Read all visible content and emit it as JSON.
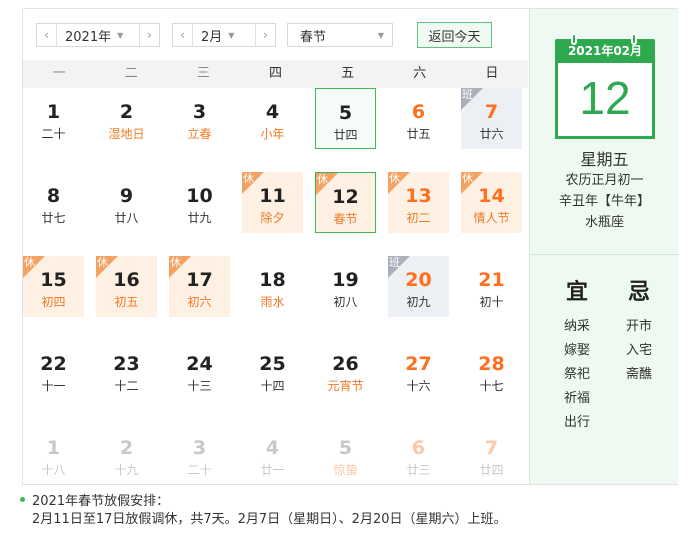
{
  "toolbar": {
    "year": "2021年",
    "month": "2月",
    "holiday": "春节",
    "today_label": "返回今天"
  },
  "weekdays": [
    "一",
    "二",
    "三",
    "四",
    "五",
    "六",
    "日"
  ],
  "days": [
    {
      "n": "1",
      "l": "二十"
    },
    {
      "n": "2",
      "l": "湿地日",
      "fest": true
    },
    {
      "n": "3",
      "l": "立春",
      "fest": true
    },
    {
      "n": "4",
      "l": "小年",
      "fest": true
    },
    {
      "n": "5",
      "l": "廿四",
      "selected": true
    },
    {
      "n": "6",
      "l": "廿五"
    },
    {
      "n": "7",
      "l": "廿六",
      "tag": "班"
    },
    {
      "n": "8",
      "l": "廿七"
    },
    {
      "n": "9",
      "l": "廿八"
    },
    {
      "n": "10",
      "l": "廿九"
    },
    {
      "n": "11",
      "l": "除夕",
      "fest": true,
      "tag": "休"
    },
    {
      "n": "12",
      "l": "春节",
      "fest": true,
      "tag": "休",
      "selected": true
    },
    {
      "n": "13",
      "l": "初二",
      "fest": true,
      "tag": "休"
    },
    {
      "n": "14",
      "l": "情人节",
      "fest": true,
      "tag": "休"
    },
    {
      "n": "15",
      "l": "初四",
      "fest": true,
      "tag": "休"
    },
    {
      "n": "16",
      "l": "初五",
      "fest": true,
      "tag": "休"
    },
    {
      "n": "17",
      "l": "初六",
      "fest": true,
      "tag": "休"
    },
    {
      "n": "18",
      "l": "雨水",
      "fest": true
    },
    {
      "n": "19",
      "l": "初八"
    },
    {
      "n": "20",
      "l": "初九",
      "tag": "班"
    },
    {
      "n": "21",
      "l": "初十"
    },
    {
      "n": "22",
      "l": "十一"
    },
    {
      "n": "23",
      "l": "十二"
    },
    {
      "n": "24",
      "l": "十三"
    },
    {
      "n": "25",
      "l": "十四"
    },
    {
      "n": "26",
      "l": "元宵节",
      "fest": true
    },
    {
      "n": "27",
      "l": "十六"
    },
    {
      "n": "28",
      "l": "十七"
    },
    {
      "n": "1",
      "l": "十八",
      "other": true
    },
    {
      "n": "2",
      "l": "十九",
      "other": true
    },
    {
      "n": "3",
      "l": "二十",
      "other": true
    },
    {
      "n": "4",
      "l": "廿一",
      "other": true
    },
    {
      "n": "5",
      "l": "惊蛰",
      "fest": true,
      "other": true
    },
    {
      "n": "6",
      "l": "廿三",
      "other": true
    },
    {
      "n": "7",
      "l": "廿四",
      "other": true
    }
  ],
  "side": {
    "header": "2021年02月",
    "big_day": "12",
    "weekday": "星期五",
    "lunar": "农历正月初一",
    "ganzhi": "辛丑年【牛年】",
    "zodiac": "水瓶座"
  },
  "yi": {
    "title": "宜",
    "items": [
      "纳采",
      "嫁娶",
      "祭祀",
      "祈福",
      "出行"
    ]
  },
  "ji": {
    "title": "忌",
    "items": [
      "开市",
      "入宅",
      "斋醮"
    ]
  },
  "notice": {
    "title": "2021年春节放假安排：",
    "body": "2月11日至17日放假调休，共7天。2月7日（星期日）、2月20日（星期六）上班。"
  },
  "colors": {
    "accent": "#2fa94f",
    "weekend": "#ff6f1d",
    "rest_bg": "#fff0e4",
    "work_bg": "#eceff3"
  }
}
